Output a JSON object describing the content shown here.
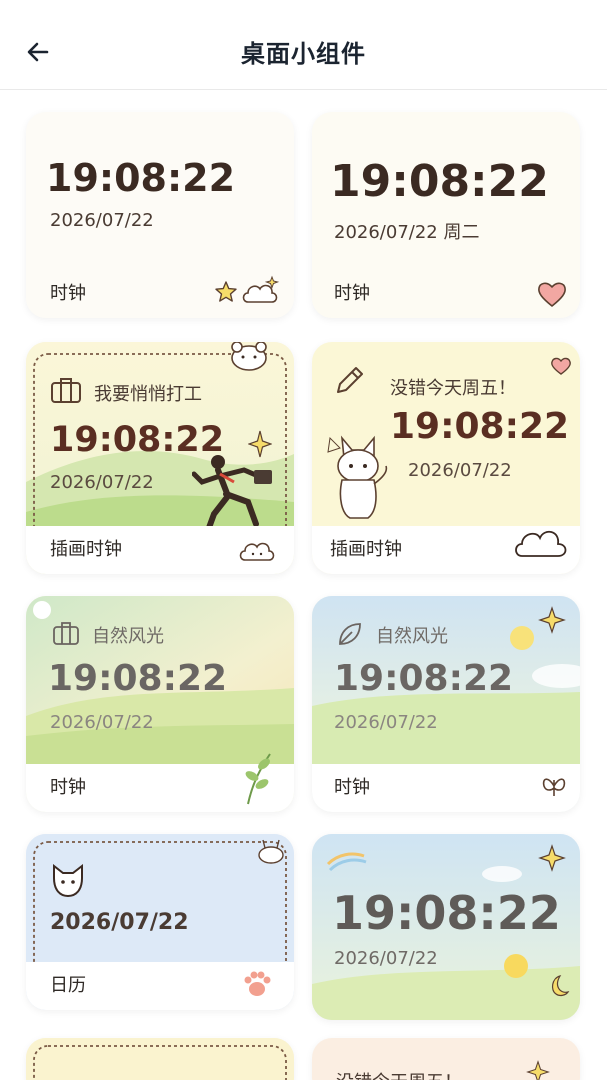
{
  "header": {
    "title": "桌面小组件",
    "back_icon": "arrow-left-icon"
  },
  "widgets": [
    {
      "time": "19:08:22",
      "date": "2026/07/22",
      "label": "时钟"
    },
    {
      "time": "19:08:22",
      "date": "2026/07/22 周二",
      "label": "时钟"
    },
    {
      "subtitle": "我要悄悄打工",
      "time": "19:08:22",
      "date": "2026/07/22",
      "label": "插画时钟"
    },
    {
      "subtitle": "没错今天周五！",
      "time": "19:08:22",
      "date": "2026/07/22",
      "label": "插画时钟"
    },
    {
      "subtitle": "自然风光",
      "time": "19:08:22",
      "date": "2026/07/22",
      "label": "时钟"
    },
    {
      "subtitle": "自然风光",
      "time": "19:08:22",
      "date": "2026/07/22",
      "label": "时钟"
    },
    {
      "date": "2026/07/22",
      "label": "日历"
    },
    {
      "time": "19:08:22",
      "date": "2026/07/22"
    },
    {},
    {
      "subtitle": "没错今天周五！"
    }
  ],
  "colors": {
    "brown_text": "#4a2e22",
    "gray_text": "#6f6a66",
    "header_text": "#1b2430"
  }
}
